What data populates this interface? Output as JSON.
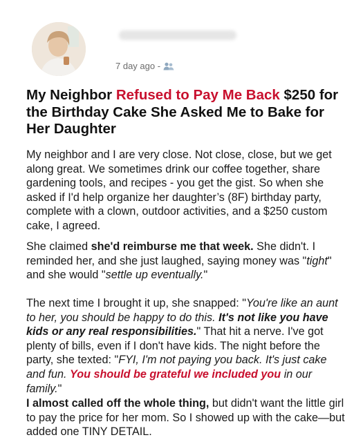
{
  "post": {
    "meta": {
      "time": "7 day ago -",
      "audience_icon": "people-icon"
    },
    "title": {
      "part1": "My Neighbor ",
      "highlight": "Refused to Pay Me Back",
      "part2": " $250 for the Birthday Cake She Asked Me to Bake for Her Daughter"
    },
    "p1": "My neighbor and I are very close. Not close, close, but we get along great. We sometimes drink our coffee together, share gardening tools, and recipes - you get the gist. So when she asked if I'd help organize her daughter’s (8F) birthday party, complete with a clown, outdoor activities, and a $250 custom cake, I agreed.",
    "p2": {
      "a": "She claimed ",
      "b_bold": "she'd reimburse me that week.",
      "c": " She didn't. I reminded her, and she just laughed, saying money was \"",
      "d_italic": "tight",
      "e": "\" and she would \"",
      "f_italic": "settle up eventually.",
      "g": "\""
    },
    "p3": {
      "a": "The next time I brought it up, she snapped: \"",
      "b_italic": "You're like an aunt to her, you should be happy to do this. ",
      "c_bolditalic": "It's not like you have kids or any real responsibilities.",
      "d": "\" That hit a nerve. I've got plenty of bills, even if I don't have kids. The night before the party, she texted: \"",
      "e_italic": "FYI, I'm not paying you back. It's just cake and fun. ",
      "f_red_bolditalic": "You should be grateful we included you",
      "g_italic": " in our family.",
      "h": "\""
    },
    "p4": {
      "a_bold": "I almost called off the whole thing,",
      "b": " but didn't want the little girl to pay the price for her mom. So I showed up with the cake—but added one TINY DETAIL."
    },
    "colors": {
      "accent_red": "#c8102e",
      "text": "#1a1a1a",
      "meta": "#6b6b6b",
      "people_icon": "#8fa8bf"
    }
  }
}
